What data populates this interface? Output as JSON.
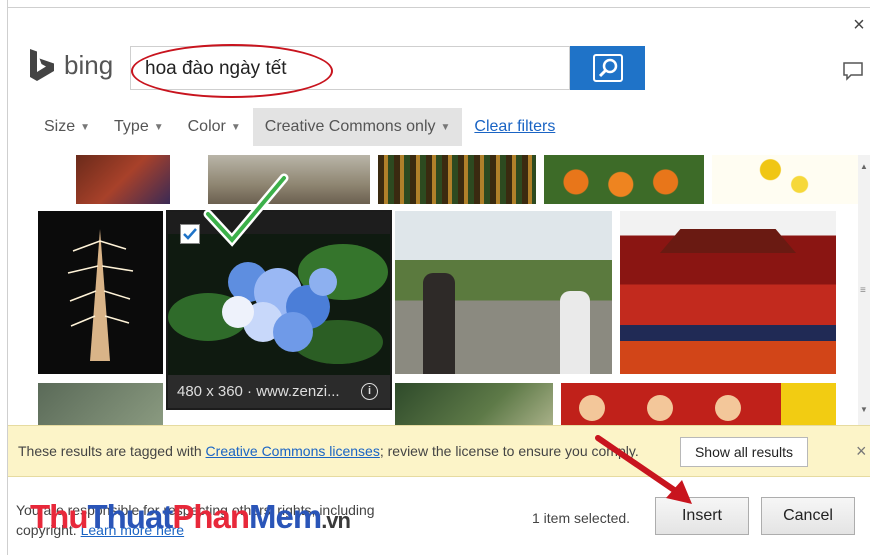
{
  "dialog": {
    "close_glyph": "×"
  },
  "header": {
    "brand": "bing",
    "search_value": "hoa đào ngày tết",
    "search_icon": "search-icon",
    "feedback_icon": "comment-icon"
  },
  "filters": {
    "items": [
      {
        "label": "Size"
      },
      {
        "label": "Type"
      },
      {
        "label": "Color"
      },
      {
        "label": "Creative Commons only"
      }
    ],
    "clear_label": "Clear filters"
  },
  "selected_image": {
    "caption": "480 x 360 · www.zenzi...",
    "info_glyph": "i"
  },
  "notice": {
    "text_before": "These results are tagged with ",
    "link": "Creative Commons licenses",
    "text_after": "; review the license to ensure you comply.",
    "show_all_label": "Show all results",
    "close_glyph": "×"
  },
  "footer": {
    "legal_line1": "You are responsible for respecting others' rights, including",
    "legal_line2_prefix": "copyright. ",
    "legal_link": "Learn more here",
    "watermark_red_1": "Thu",
    "watermark_blue_1": "Thuat",
    "watermark_red_2": "Phan",
    "watermark_blue_2": "Mem",
    "watermark_suffix": ".vn",
    "status": "1 item selected.",
    "insert_label": "Insert",
    "cancel_label": "Cancel"
  },
  "colors": {
    "accent": "#1f73c8",
    "notice_bg": "#fcf4c8",
    "annotation_red": "#c8141e"
  }
}
